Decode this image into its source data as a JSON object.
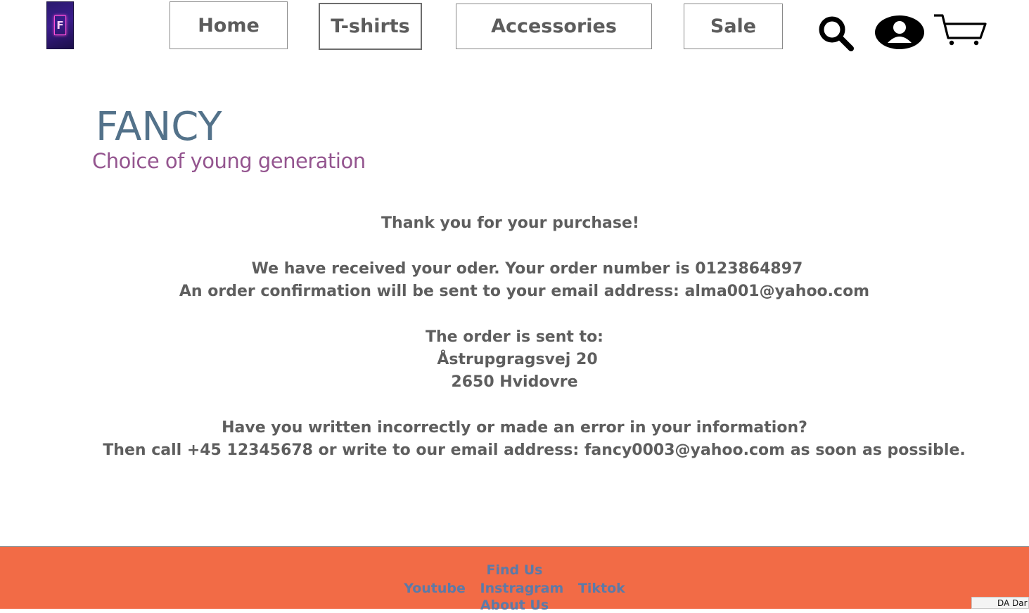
{
  "logo": {
    "letter": "F"
  },
  "nav": {
    "home": "Home",
    "tshirts": "T-shirts",
    "accessories": "Accessories",
    "sale": "Sale"
  },
  "icons": {
    "search": "search-icon",
    "account": "user-icon",
    "cart": "cart-icon"
  },
  "brand": {
    "name": "FANCY",
    "tagline": "Choice of young generation"
  },
  "confirmation": {
    "heading": "Thank you for your purchase!",
    "received": "We have received your oder. Your order number is 0123864897",
    "email_note": "An order confirmation will be sent to your email address: alma001@yahoo.com",
    "sent_to_label": "The order is sent to:",
    "address_line1": "Åstrupgragsvej 20",
    "address_line2": "2650 Hvidovre",
    "error_question": "Have you written incorrectly or made an error in your information?",
    "error_contact": "Then call +45 12345678 or write to our email address: fancy0003@yahoo.com as soon as possible."
  },
  "footer": {
    "find_us": "Find Us",
    "youtube": "Youtube",
    "instagram": "Instragram",
    "tiktok": "Tiktok",
    "about": "About Us"
  },
  "taskbar_fragment": "DA Dar",
  "colors": {
    "brand_title": "#53728a",
    "tagline": "#94558f",
    "footer_bg": "#f26b46",
    "footer_text": "#5b7aa8",
    "body_text": "#5e5e5e"
  }
}
